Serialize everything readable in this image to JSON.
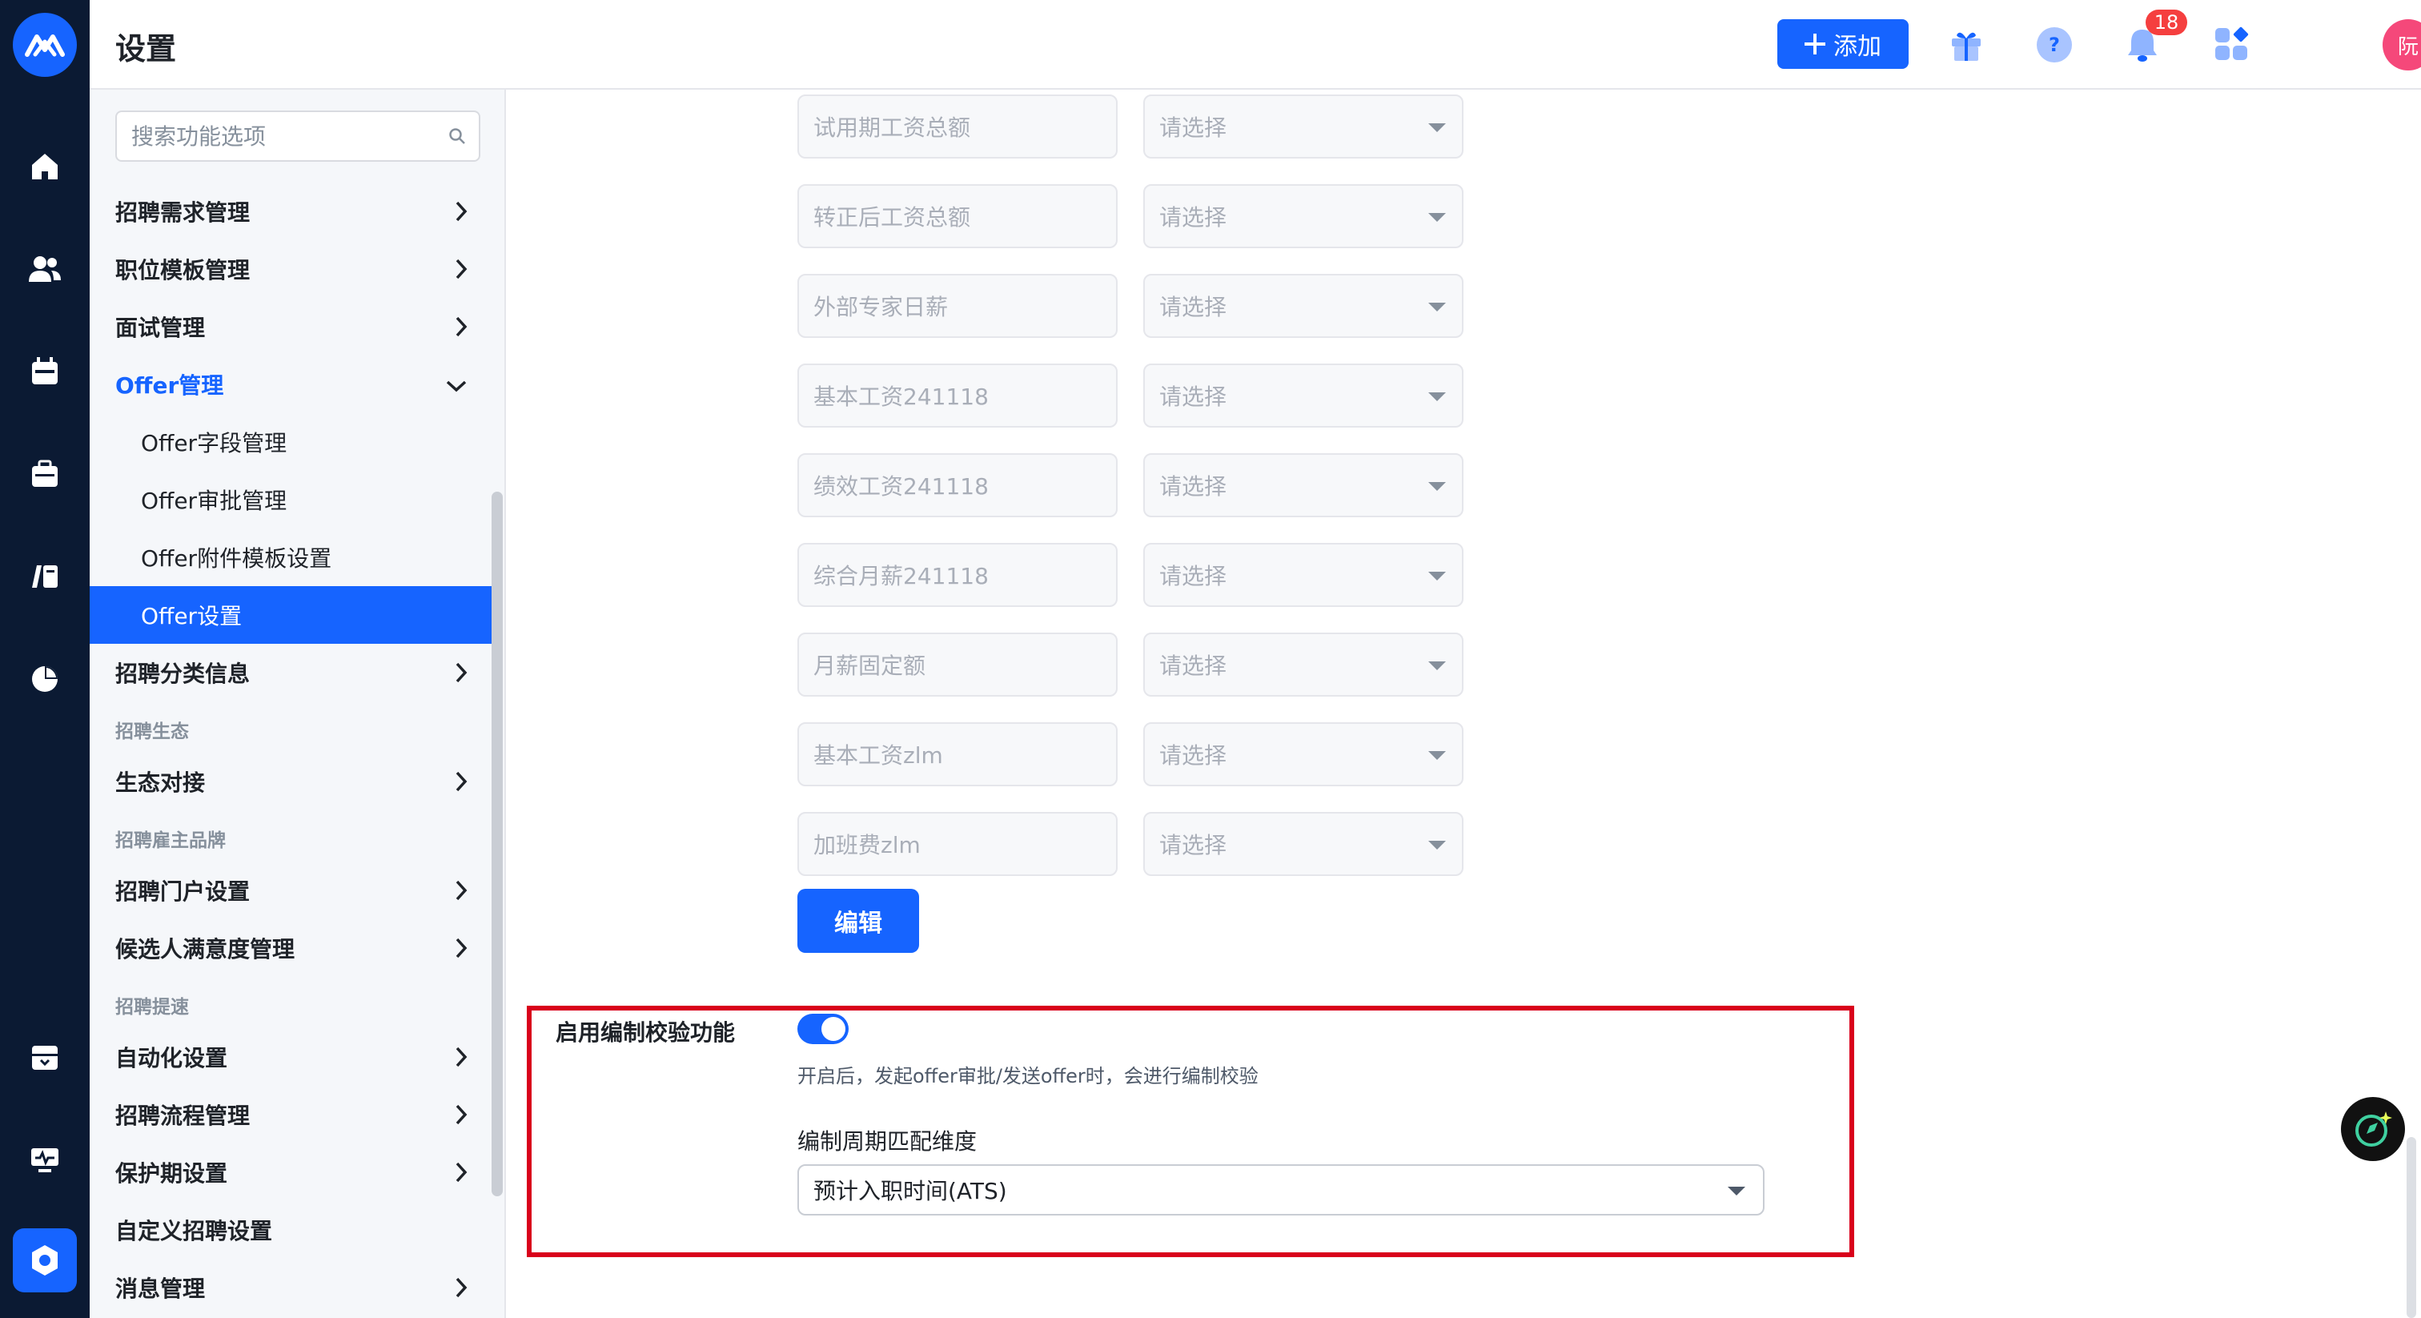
{
  "header": {
    "title": "设置",
    "add_label": "添加",
    "notification_count": "18",
    "avatar_text": "阮"
  },
  "sidebar": {
    "search_placeholder": "搜索功能选项",
    "items": [
      {
        "label": "招聘需求管理"
      },
      {
        "label": "职位模板管理"
      },
      {
        "label": "面试管理"
      },
      {
        "label": "Offer管理"
      },
      {
        "label": "Offer字段管理"
      },
      {
        "label": "Offer审批管理"
      },
      {
        "label": "Offer附件模板设置"
      },
      {
        "label": "Offer设置"
      },
      {
        "label": "招聘分类信息"
      },
      {
        "label": "招聘生态"
      },
      {
        "label": "生态对接"
      },
      {
        "label": "招聘雇主品牌"
      },
      {
        "label": "招聘门户设置"
      },
      {
        "label": "候选人满意度管理"
      },
      {
        "label": "招聘提速"
      },
      {
        "label": "自动化设置"
      },
      {
        "label": "招聘流程管理"
      },
      {
        "label": "保护期设置"
      },
      {
        "label": "自定义招聘设置"
      },
      {
        "label": "消息管理"
      }
    ]
  },
  "content": {
    "fields": [
      {
        "name": "试用期工资总额",
        "select": "请选择"
      },
      {
        "name": "转正后工资总额",
        "select": "请选择"
      },
      {
        "name": "外部专家日薪",
        "select": "请选择"
      },
      {
        "name": "基本工资241118",
        "select": "请选择"
      },
      {
        "name": "绩效工资241118",
        "select": "请选择"
      },
      {
        "name": "综合月薪241118",
        "select": "请选择"
      },
      {
        "name": "月薪固定额",
        "select": "请选择"
      },
      {
        "name": "基本工资zlm",
        "select": "请选择"
      },
      {
        "name": "加班费zlm",
        "select": "请选择"
      }
    ],
    "edit_label": "编辑",
    "toggle_label": "启用编制校验功能",
    "toggle_hint": "开启后，发起offer审批/发送offer时，会进行编制校验",
    "dimension_label": "编制周期匹配维度",
    "dimension_value": "预计入职时间(ATS)"
  },
  "colors": {
    "rail": "#0b1a33",
    "primary": "#1664ff",
    "highlight": "#d9001b",
    "badge": "#f53f3f",
    "avatar": "#f5487a"
  },
  "icons": [
    "logo-icon",
    "home-icon",
    "users-icon",
    "calendar-icon",
    "briefcase-icon",
    "book-icon",
    "pie-chart-icon",
    "archive-icon",
    "monitor-icon",
    "settings-icon",
    "plus-icon",
    "gift-icon",
    "help-icon",
    "bell-icon",
    "apps-icon",
    "search-icon",
    "chevron-right-icon",
    "chevron-down-icon",
    "ai-assistant-icon"
  ]
}
